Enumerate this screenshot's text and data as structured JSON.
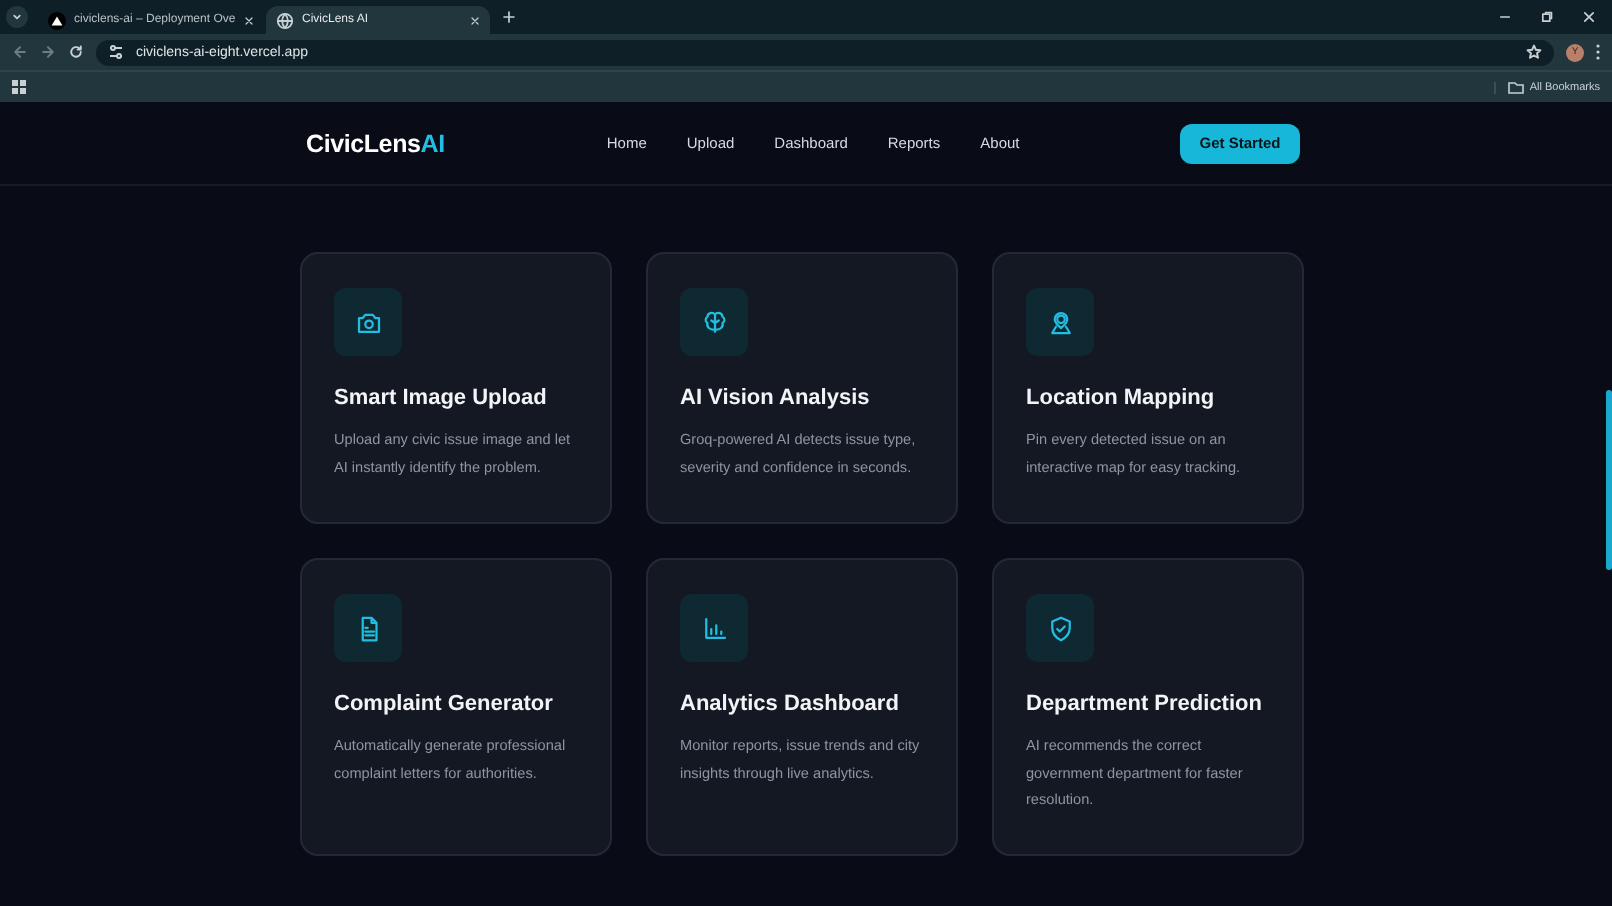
{
  "browser": {
    "tabs": [
      {
        "title": "civiclens-ai – Deployment Ove",
        "selected": false,
        "kind": "deploy"
      },
      {
        "title": "CivicLens AI",
        "selected": true,
        "kind": "globe"
      }
    ],
    "url": "civiclens-ai-eight.vercel.app",
    "profile": "Y",
    "bookmarks": "All Bookmarks"
  },
  "nav": {
    "logo": "CivicLens",
    "logo_accent": "AI",
    "links": [
      "Home",
      "Upload",
      "Dashboard",
      "Reports",
      "About"
    ],
    "cta": "Get Started"
  },
  "features": [
    {
      "kind": "camera",
      "title": "Smart Image Upload",
      "description": "Upload any civic issue image and let AI instantly identify the problem."
    },
    {
      "kind": "brain",
      "title": "AI Vision Analysis",
      "description": "Groq-powered AI detects issue type, severity and confidence in seconds."
    },
    {
      "kind": "pin",
      "title": "Location Mapping",
      "description": "Pin every detected issue on an interactive map for easy tracking."
    },
    {
      "kind": "document",
      "title": "Complaint Generator",
      "description": "Automatically generate professional complaint letters for authorities."
    },
    {
      "kind": "chart",
      "title": "Analytics Dashboard",
      "description": "Monitor reports, issue trends and city insights through live analytics."
    },
    {
      "kind": "shield",
      "title": "Department Prediction",
      "description": "AI recommends the correct government department for faster resolution."
    }
  ]
}
